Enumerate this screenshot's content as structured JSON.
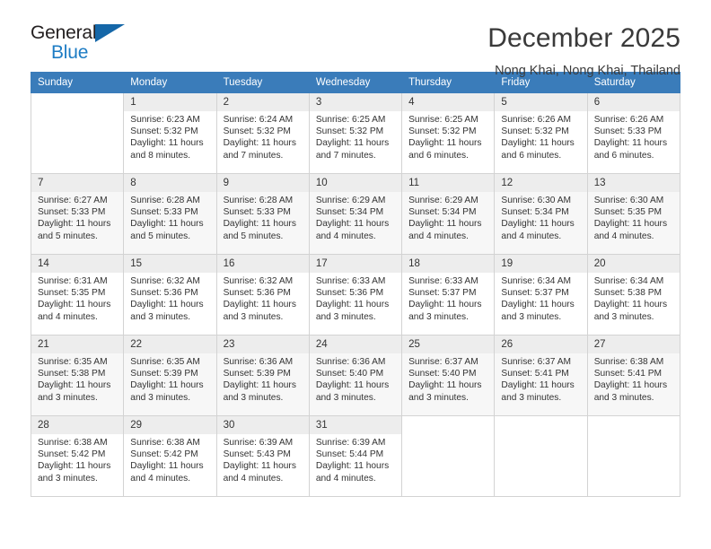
{
  "brand": {
    "name_part1": "General",
    "name_part2": "Blue",
    "accent_color": "#1d7cc4",
    "header_color": "#3a7cba"
  },
  "header": {
    "title": "December 2025",
    "subtitle": "Nong Khai, Nong Khai, Thailand"
  },
  "weekday_headers": [
    "Sunday",
    "Monday",
    "Tuesday",
    "Wednesday",
    "Thursday",
    "Friday",
    "Saturday"
  ],
  "days": [
    {
      "num": "",
      "sunrise": "",
      "sunset": "",
      "daylight1": "",
      "daylight2": ""
    },
    {
      "num": "1",
      "sunrise": "Sunrise: 6:23 AM",
      "sunset": "Sunset: 5:32 PM",
      "daylight1": "Daylight: 11 hours",
      "daylight2": "and 8 minutes."
    },
    {
      "num": "2",
      "sunrise": "Sunrise: 6:24 AM",
      "sunset": "Sunset: 5:32 PM",
      "daylight1": "Daylight: 11 hours",
      "daylight2": "and 7 minutes."
    },
    {
      "num": "3",
      "sunrise": "Sunrise: 6:25 AM",
      "sunset": "Sunset: 5:32 PM",
      "daylight1": "Daylight: 11 hours",
      "daylight2": "and 7 minutes."
    },
    {
      "num": "4",
      "sunrise": "Sunrise: 6:25 AM",
      "sunset": "Sunset: 5:32 PM",
      "daylight1": "Daylight: 11 hours",
      "daylight2": "and 6 minutes."
    },
    {
      "num": "5",
      "sunrise": "Sunrise: 6:26 AM",
      "sunset": "Sunset: 5:32 PM",
      "daylight1": "Daylight: 11 hours",
      "daylight2": "and 6 minutes."
    },
    {
      "num": "6",
      "sunrise": "Sunrise: 6:26 AM",
      "sunset": "Sunset: 5:33 PM",
      "daylight1": "Daylight: 11 hours",
      "daylight2": "and 6 minutes."
    },
    {
      "num": "7",
      "sunrise": "Sunrise: 6:27 AM",
      "sunset": "Sunset: 5:33 PM",
      "daylight1": "Daylight: 11 hours",
      "daylight2": "and 5 minutes."
    },
    {
      "num": "8",
      "sunrise": "Sunrise: 6:28 AM",
      "sunset": "Sunset: 5:33 PM",
      "daylight1": "Daylight: 11 hours",
      "daylight2": "and 5 minutes."
    },
    {
      "num": "9",
      "sunrise": "Sunrise: 6:28 AM",
      "sunset": "Sunset: 5:33 PM",
      "daylight1": "Daylight: 11 hours",
      "daylight2": "and 5 minutes."
    },
    {
      "num": "10",
      "sunrise": "Sunrise: 6:29 AM",
      "sunset": "Sunset: 5:34 PM",
      "daylight1": "Daylight: 11 hours",
      "daylight2": "and 4 minutes."
    },
    {
      "num": "11",
      "sunrise": "Sunrise: 6:29 AM",
      "sunset": "Sunset: 5:34 PM",
      "daylight1": "Daylight: 11 hours",
      "daylight2": "and 4 minutes."
    },
    {
      "num": "12",
      "sunrise": "Sunrise: 6:30 AM",
      "sunset": "Sunset: 5:34 PM",
      "daylight1": "Daylight: 11 hours",
      "daylight2": "and 4 minutes."
    },
    {
      "num": "13",
      "sunrise": "Sunrise: 6:30 AM",
      "sunset": "Sunset: 5:35 PM",
      "daylight1": "Daylight: 11 hours",
      "daylight2": "and 4 minutes."
    },
    {
      "num": "14",
      "sunrise": "Sunrise: 6:31 AM",
      "sunset": "Sunset: 5:35 PM",
      "daylight1": "Daylight: 11 hours",
      "daylight2": "and 4 minutes."
    },
    {
      "num": "15",
      "sunrise": "Sunrise: 6:32 AM",
      "sunset": "Sunset: 5:36 PM",
      "daylight1": "Daylight: 11 hours",
      "daylight2": "and 3 minutes."
    },
    {
      "num": "16",
      "sunrise": "Sunrise: 6:32 AM",
      "sunset": "Sunset: 5:36 PM",
      "daylight1": "Daylight: 11 hours",
      "daylight2": "and 3 minutes."
    },
    {
      "num": "17",
      "sunrise": "Sunrise: 6:33 AM",
      "sunset": "Sunset: 5:36 PM",
      "daylight1": "Daylight: 11 hours",
      "daylight2": "and 3 minutes."
    },
    {
      "num": "18",
      "sunrise": "Sunrise: 6:33 AM",
      "sunset": "Sunset: 5:37 PM",
      "daylight1": "Daylight: 11 hours",
      "daylight2": "and 3 minutes."
    },
    {
      "num": "19",
      "sunrise": "Sunrise: 6:34 AM",
      "sunset": "Sunset: 5:37 PM",
      "daylight1": "Daylight: 11 hours",
      "daylight2": "and 3 minutes."
    },
    {
      "num": "20",
      "sunrise": "Sunrise: 6:34 AM",
      "sunset": "Sunset: 5:38 PM",
      "daylight1": "Daylight: 11 hours",
      "daylight2": "and 3 minutes."
    },
    {
      "num": "21",
      "sunrise": "Sunrise: 6:35 AM",
      "sunset": "Sunset: 5:38 PM",
      "daylight1": "Daylight: 11 hours",
      "daylight2": "and 3 minutes."
    },
    {
      "num": "22",
      "sunrise": "Sunrise: 6:35 AM",
      "sunset": "Sunset: 5:39 PM",
      "daylight1": "Daylight: 11 hours",
      "daylight2": "and 3 minutes."
    },
    {
      "num": "23",
      "sunrise": "Sunrise: 6:36 AM",
      "sunset": "Sunset: 5:39 PM",
      "daylight1": "Daylight: 11 hours",
      "daylight2": "and 3 minutes."
    },
    {
      "num": "24",
      "sunrise": "Sunrise: 6:36 AM",
      "sunset": "Sunset: 5:40 PM",
      "daylight1": "Daylight: 11 hours",
      "daylight2": "and 3 minutes."
    },
    {
      "num": "25",
      "sunrise": "Sunrise: 6:37 AM",
      "sunset": "Sunset: 5:40 PM",
      "daylight1": "Daylight: 11 hours",
      "daylight2": "and 3 minutes."
    },
    {
      "num": "26",
      "sunrise": "Sunrise: 6:37 AM",
      "sunset": "Sunset: 5:41 PM",
      "daylight1": "Daylight: 11 hours",
      "daylight2": "and 3 minutes."
    },
    {
      "num": "27",
      "sunrise": "Sunrise: 6:38 AM",
      "sunset": "Sunset: 5:41 PM",
      "daylight1": "Daylight: 11 hours",
      "daylight2": "and 3 minutes."
    },
    {
      "num": "28",
      "sunrise": "Sunrise: 6:38 AM",
      "sunset": "Sunset: 5:42 PM",
      "daylight1": "Daylight: 11 hours",
      "daylight2": "and 3 minutes."
    },
    {
      "num": "29",
      "sunrise": "Sunrise: 6:38 AM",
      "sunset": "Sunset: 5:42 PM",
      "daylight1": "Daylight: 11 hours",
      "daylight2": "and 4 minutes."
    },
    {
      "num": "30",
      "sunrise": "Sunrise: 6:39 AM",
      "sunset": "Sunset: 5:43 PM",
      "daylight1": "Daylight: 11 hours",
      "daylight2": "and 4 minutes."
    },
    {
      "num": "31",
      "sunrise": "Sunrise: 6:39 AM",
      "sunset": "Sunset: 5:44 PM",
      "daylight1": "Daylight: 11 hours",
      "daylight2": "and 4 minutes."
    },
    {
      "num": "",
      "sunrise": "",
      "sunset": "",
      "daylight1": "",
      "daylight2": ""
    },
    {
      "num": "",
      "sunrise": "",
      "sunset": "",
      "daylight1": "",
      "daylight2": ""
    },
    {
      "num": "",
      "sunrise": "",
      "sunset": "",
      "daylight1": "",
      "daylight2": ""
    }
  ]
}
